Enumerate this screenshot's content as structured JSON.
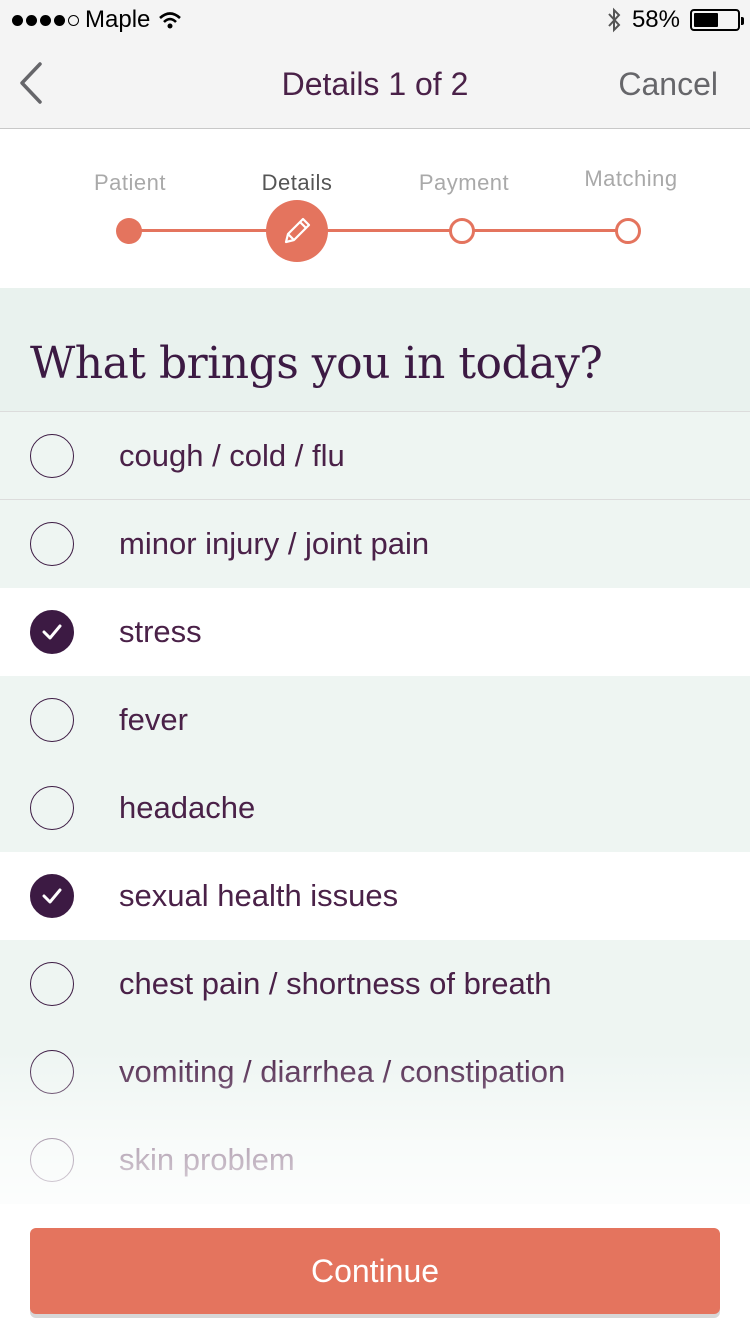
{
  "status_bar": {
    "carrier": "Maple",
    "battery_percent": "58%",
    "battery_level": 0.58,
    "signal_icon": "signal-dots-icon",
    "wifi_icon": "wifi-icon",
    "bluetooth_icon": "bluetooth-icon"
  },
  "nav": {
    "back_icon": "chevron-left-icon",
    "title": "Details 1 of 2",
    "cancel_label": "Cancel"
  },
  "stepper": {
    "steps": [
      {
        "label": "Patient",
        "state": "done"
      },
      {
        "label": "Details",
        "state": "current",
        "icon": "pencil-icon"
      },
      {
        "label": "Payment",
        "state": "future"
      },
      {
        "label": "Matching",
        "state": "future"
      }
    ]
  },
  "question": {
    "title": "What brings you in today?"
  },
  "options": [
    {
      "label": "cough / cold / flu",
      "checked": false
    },
    {
      "label": "minor injury / joint pain",
      "checked": false
    },
    {
      "label": "stress",
      "checked": true
    },
    {
      "label": "fever",
      "checked": false
    },
    {
      "label": "headache",
      "checked": false
    },
    {
      "label": "sexual health issues",
      "checked": true
    },
    {
      "label": "chest pain / shortness of breath",
      "checked": false
    },
    {
      "label": "vomiting / diarrhea / constipation",
      "checked": false
    },
    {
      "label": "skin problem",
      "checked": false
    }
  ],
  "actions": {
    "continue_label": "Continue"
  },
  "colors": {
    "accent": "#e4745e",
    "text_primary": "#4a2148",
    "checked": "#3c1a43",
    "row_tint": "#eef5f2"
  }
}
